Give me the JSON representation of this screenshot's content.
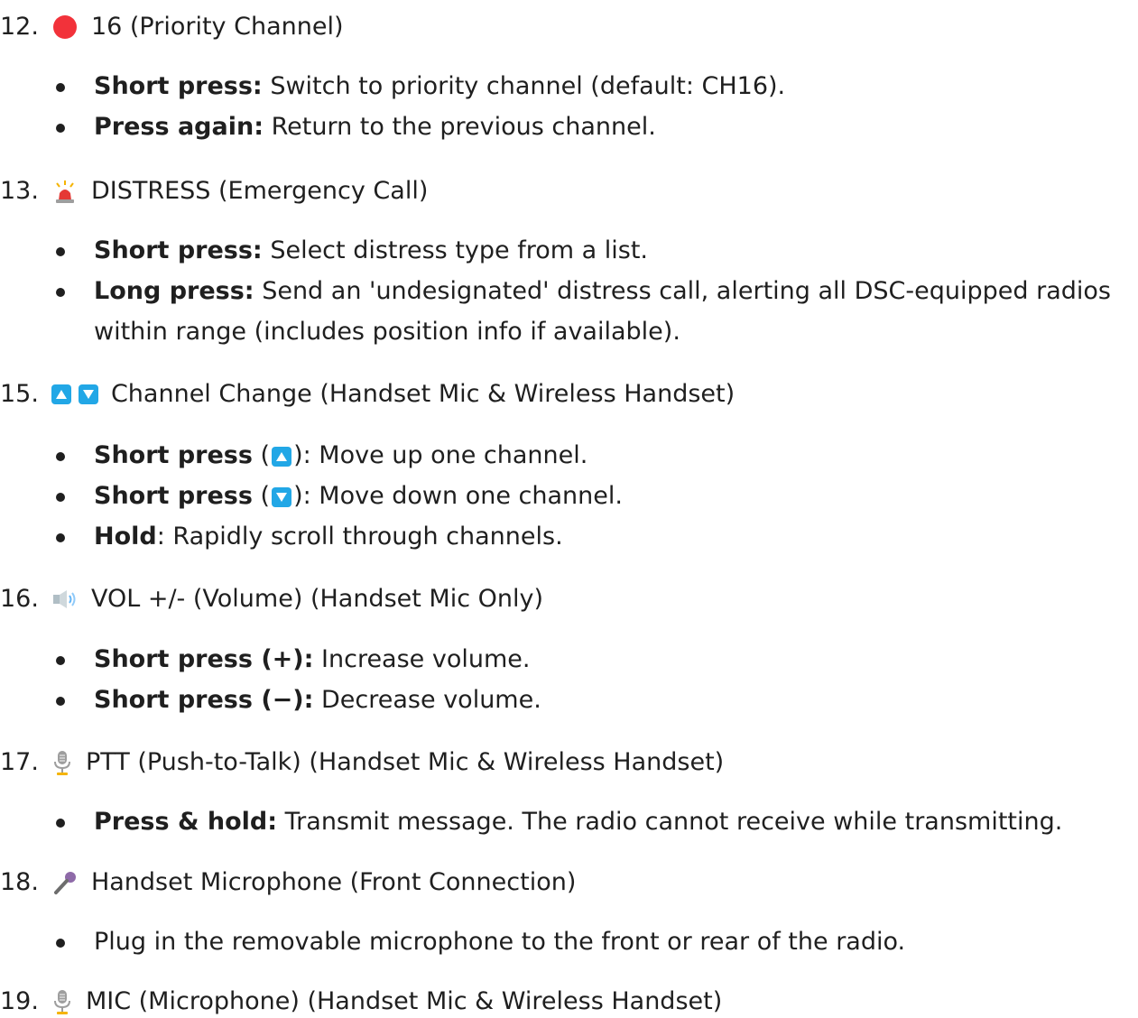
{
  "items": [
    {
      "number": "12.",
      "icon": "red-circle-icon",
      "title": "16 (Priority Channel)",
      "bullets": [
        {
          "bold": "Short press:",
          "text": " Switch to priority channel (default: CH16)."
        },
        {
          "bold": "Press again:",
          "text": " Return to the previous channel."
        }
      ]
    },
    {
      "number": "13.",
      "icon": "siren-icon",
      "title": "DISTRESS (Emergency Call)",
      "bullets": [
        {
          "bold": "Short press:",
          "text": " Select distress type from a list."
        },
        {
          "bold": "Long press:",
          "text": " Send an 'undesignated' distress call, alerting all DSC-equipped radios within range (includes position info if available)."
        }
      ]
    },
    {
      "number": "15.",
      "icons": [
        "up-triangle-button-icon",
        "down-triangle-button-icon"
      ],
      "title": "Channel Change (Handset Mic & Wireless Handset)",
      "bullets": [
        {
          "bold": "Short press",
          "pre": " (",
          "icon": "up-triangle-button-icon",
          "text": "): Move up one channel."
        },
        {
          "bold": "Short press",
          "pre": " (",
          "icon": "down-triangle-button-icon",
          "text": "): Move down one channel."
        },
        {
          "bold": "Hold",
          "text": ": Rapidly scroll through channels."
        }
      ]
    },
    {
      "number": "16.",
      "icon": "speaker-icon",
      "title": "VOL +/- (Volume) (Handset Mic Only)",
      "bullets": [
        {
          "bold": "Short press (+):",
          "text": " Increase volume."
        },
        {
          "bold": "Short press (−):",
          "text": " Decrease volume."
        }
      ]
    },
    {
      "number": "17.",
      "icon": "studio-microphone-icon",
      "title": "PTT (Push-to-Talk) (Handset Mic & Wireless Handset)",
      "bullets": [
        {
          "bold": "Press & hold:",
          "text": " Transmit message. The radio cannot receive while transmitting."
        }
      ]
    },
    {
      "number": "18.",
      "icon": "handheld-microphone-icon",
      "title": "Handset Microphone (Front Connection)",
      "bullets": [
        {
          "bold": "",
          "text": "Plug in the removable microphone to the front or rear of the radio."
        }
      ]
    },
    {
      "number": "19.",
      "icon": "studio-microphone-icon",
      "title": "MIC (Microphone) (Handset Mic & Wireless Handset)",
      "bullets": []
    }
  ],
  "colors": {
    "text": "#1f1f1f",
    "red": "#f2323a",
    "blue": "#22a7e6"
  }
}
